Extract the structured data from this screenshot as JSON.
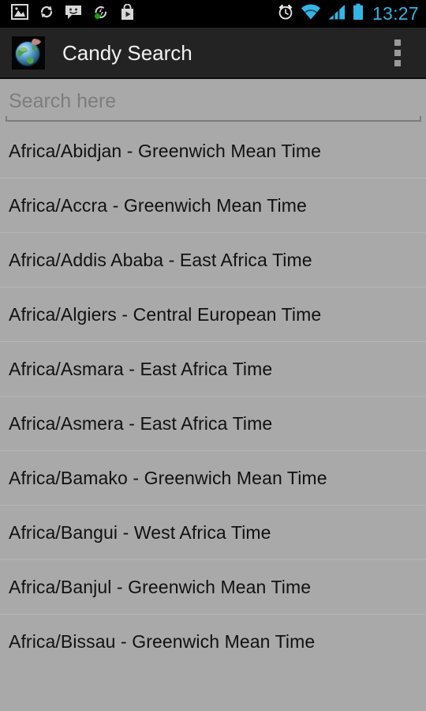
{
  "status_bar": {
    "background": "#000000",
    "accent": "#33b5e5",
    "time": "13:27",
    "left_icons": [
      {
        "name": "image-icon",
        "label": "Screenshot captured"
      },
      {
        "name": "sync-icon",
        "label": "Sync"
      },
      {
        "name": "message-icon",
        "label": "Messages"
      },
      {
        "name": "flash-sync-icon",
        "label": "App activity"
      },
      {
        "name": "play-store-icon",
        "label": "Play Store"
      }
    ],
    "right_icons": [
      {
        "name": "alarm-icon",
        "label": "Alarm set"
      },
      {
        "name": "wifi-icon",
        "label": "Wi-Fi connected"
      },
      {
        "name": "signal-icon",
        "label": "Mobile signal"
      },
      {
        "name": "battery-icon",
        "label": "Battery"
      }
    ]
  },
  "action_bar": {
    "background": "#232323",
    "app_icon": "globe-icon",
    "title": "Candy Search",
    "overflow_label": "More options"
  },
  "search": {
    "placeholder": "Search here",
    "value": ""
  },
  "list": {
    "background": "#a9a9a9",
    "items": [
      {
        "label": "Africa/Abidjan - Greenwich Mean Time"
      },
      {
        "label": "Africa/Accra - Greenwich Mean Time"
      },
      {
        "label": "Africa/Addis Ababa - East Africa Time"
      },
      {
        "label": "Africa/Algiers - Central European Time"
      },
      {
        "label": "Africa/Asmara - East Africa Time"
      },
      {
        "label": "Africa/Asmera - East Africa Time"
      },
      {
        "label": "Africa/Bamako - Greenwich Mean Time"
      },
      {
        "label": "Africa/Bangui - West Africa Time"
      },
      {
        "label": "Africa/Banjul - Greenwich Mean Time"
      },
      {
        "label": "Africa/Bissau - Greenwich Mean Time"
      }
    ]
  }
}
